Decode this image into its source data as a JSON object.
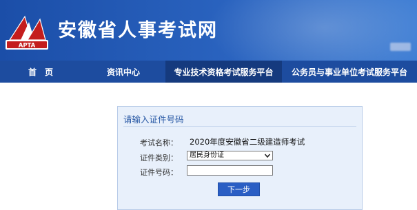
{
  "header": {
    "site_title": "安徽省人事考试网",
    "logo_text": "APTA"
  },
  "nav": {
    "items": [
      {
        "label": "首　页"
      },
      {
        "label": "资讯中心"
      },
      {
        "label": "专业技术资格考试服务平台"
      },
      {
        "label": "公务员与事业单位考试服务平台"
      }
    ],
    "active_index": 2
  },
  "form": {
    "title": "请输入证件号码",
    "exam_label": "考试名称：",
    "exam_value": "2020年度安徽省二级建造师考试",
    "id_type_label": "证件类别：",
    "id_type_selected": "居民身份证",
    "id_number_label": "证件号码：",
    "id_number_value": "",
    "next_button": "下一步"
  },
  "colors": {
    "header_blue": "#2a63bf",
    "nav_blue": "#1d4c9f",
    "nav_active": "#153a7e",
    "panel_bg": "#e8f0fb",
    "button_blue": "#2a5ec4"
  }
}
